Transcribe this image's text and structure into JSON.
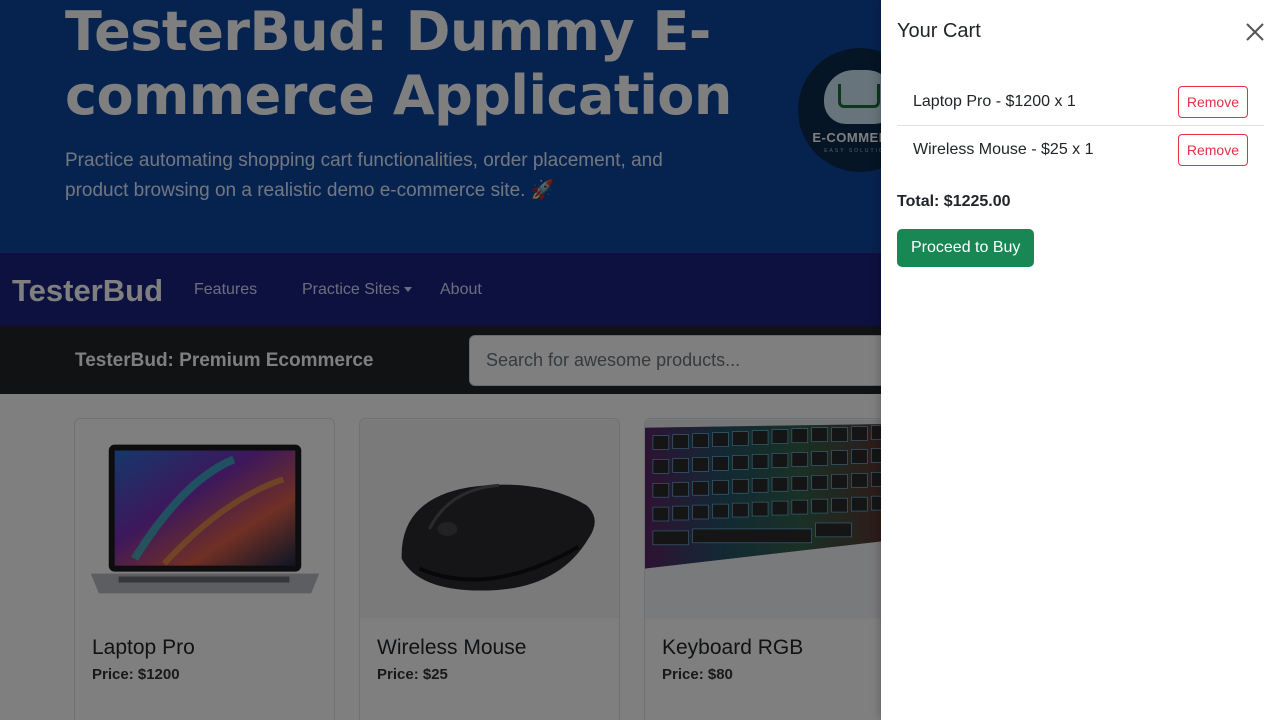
{
  "hero": {
    "title": "TesterBud: Dummy E-commerce Application",
    "subtitle": "Practice automating shopping cart functionalities, order placement, and product browsing on a realistic demo e-commerce site. 🚀",
    "logo_text": "E-COMMERCE",
    "logo_subtext": "EASY SOLUTIONS"
  },
  "navbar": {
    "brand": "TesterBud",
    "links": [
      {
        "label": "Features"
      },
      {
        "label": "Practice Sites"
      },
      {
        "label": "About"
      }
    ]
  },
  "subbar": {
    "title": "TesterBud: Premium Ecommerce",
    "search_placeholder": "Search for awesome products..."
  },
  "products": [
    {
      "name": "Laptop Pro",
      "price": "Price: $1200",
      "image": "laptop-image"
    },
    {
      "name": "Wireless Mouse",
      "price": "Price: $25",
      "image": "mouse-image"
    },
    {
      "name": "Keyboard RGB",
      "price": "Price: $80",
      "image": "keyboard-image"
    }
  ],
  "cart": {
    "title": "Your Cart",
    "items": [
      {
        "text": "Laptop Pro - $1200 x 1",
        "remove_label": "Remove"
      },
      {
        "text": "Wireless Mouse - $25 x 1",
        "remove_label": "Remove"
      }
    ],
    "total": "Total: $1225.00",
    "buy_label": "Proceed to Buy"
  },
  "colors": {
    "hero_bg": "#0d47a1",
    "navbar_bg": "#1a237e",
    "subbar_bg": "#212529",
    "danger": "#dc3545",
    "success": "#198754"
  }
}
